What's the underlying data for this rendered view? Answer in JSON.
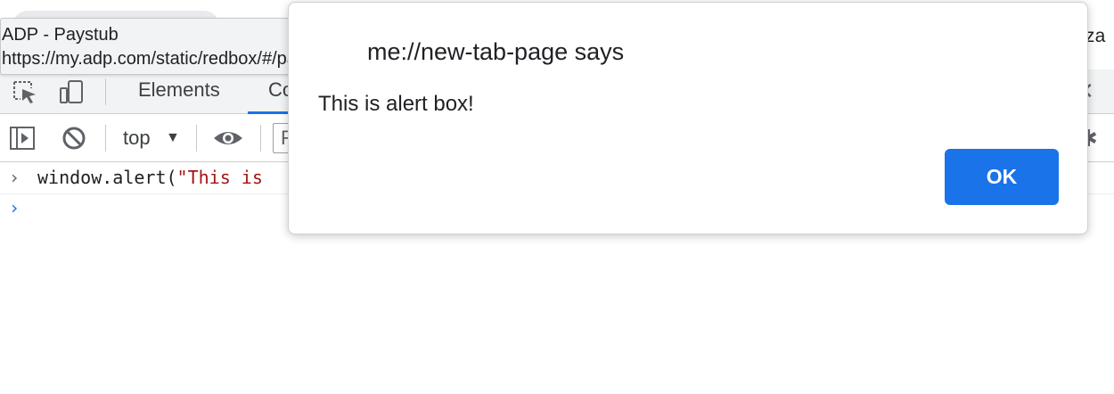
{
  "tooltip": {
    "title": "ADP - Paystub",
    "url": "https://my.adp.com/static/redbox/#/pay"
  },
  "browser": {
    "profile_text_fragment": "nza"
  },
  "devtools": {
    "tabs": [
      {
        "label": "Elements"
      },
      {
        "label": "Co",
        "active": true
      }
    ],
    "toolbar": {
      "context_label": "top",
      "context_caret": "▼",
      "filter_fragment": "F"
    },
    "console": {
      "input_code": "window.alert(",
      "input_string": "\"This is",
      "prompt_symbol": "›"
    },
    "icons": [
      "inspect-element-icon",
      "device-toggle-icon",
      "sidebar-toggle-icon",
      "clear-console-icon",
      "eye-icon",
      "close-icon",
      "settings-gear-icon"
    ]
  },
  "dialog": {
    "title": "me://new-tab-page says",
    "message": "This is alert box!",
    "ok_label": "OK",
    "ok_color": "#1a73e8"
  }
}
